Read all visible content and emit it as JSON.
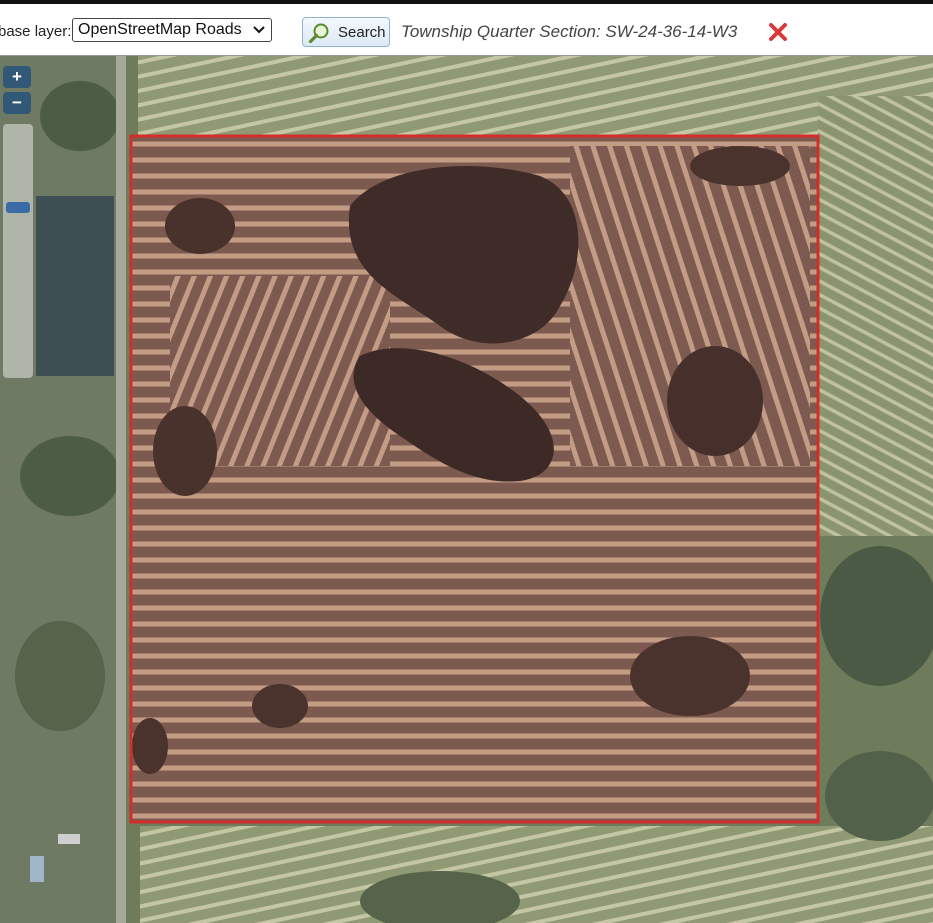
{
  "toolbar": {
    "base_layer_label": "base layer:",
    "base_layer_value": "OpenStreetMap Roads",
    "search_label": "Search",
    "result_text": "Township Quarter Section: SW-24-36-14-W3"
  },
  "map": {
    "zoom_in_label": "+",
    "zoom_out_label": "−",
    "selection_border_color": "#d62b2b",
    "clear_icon_color": "#d63a3a"
  },
  "icons": {
    "search": "search-icon",
    "clear": "close-icon",
    "dropdown": "chevron-down-icon"
  }
}
